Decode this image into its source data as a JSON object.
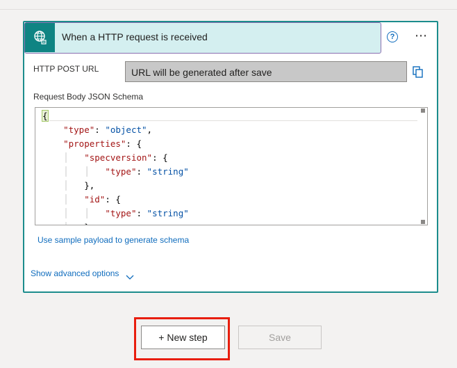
{
  "trigger": {
    "title": "When a HTTP request is received",
    "icon": "globe-request-icon",
    "accent": "#0f8483"
  },
  "fields": {
    "http_post_url_label": "HTTP POST URL",
    "http_post_url_value": "URL will be generated after save",
    "schema_label": "Request Body JSON Schema"
  },
  "schema_code": [
    "{",
    "\"type\": \"object\",",
    "\"properties\": {",
    "\"specversion\": {",
    "\"type\": \"string\"",
    "},",
    "\"id\": {",
    "\"type\": \"string\"",
    "}"
  ],
  "links": {
    "sample_payload": "Use sample payload to generate schema",
    "advanced_options": "Show advanced options"
  },
  "footer": {
    "new_step_label": "+ New step",
    "save_label": "Save"
  },
  "colors": {
    "highlight": "#e81e0e",
    "link": "#0f6cbd",
    "card_border": "#1b8c8c"
  }
}
